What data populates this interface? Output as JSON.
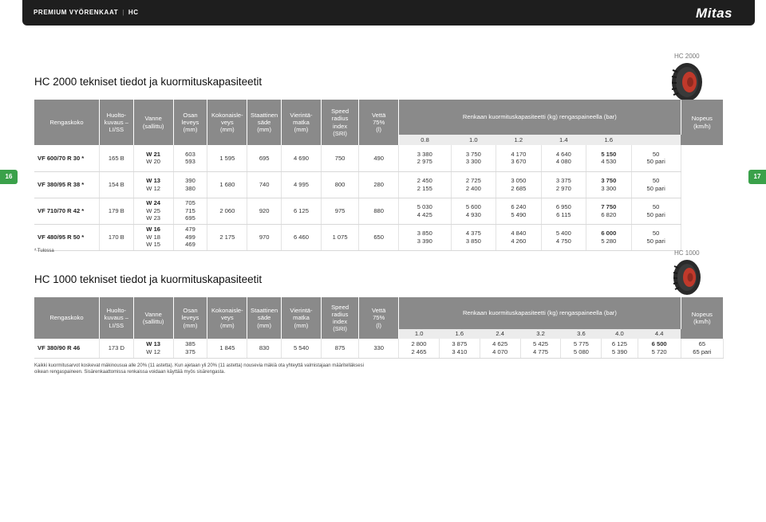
{
  "header": {
    "brand_section": "PREMIUM VYÖRENKAAT",
    "product": "HC",
    "logo": "Mitas"
  },
  "page_numbers": {
    "left": "16",
    "right": "17"
  },
  "hc2000": {
    "label": "HC 2000",
    "title": "HC 2000 tekniset tiedot ja kuormituskapasiteetit",
    "headers": {
      "size": "Rengaskoko",
      "service": "Huolto-\nkuvaus –\nLI/SS",
      "rim": "Vanne\n(sallittu)",
      "width": "Osan\nleveys\n(mm)",
      "height": "Kokonaisle-\nveys\n(mm)",
      "static_radius": "Staattinen\nsäde\n(mm)",
      "rolling": "Vierintä-\nmatka\n(mm)",
      "sri": "Speed\nradius\nindex\n(SRI)",
      "water": "Vettä\n75%\n(l)",
      "capacity": "Renkaan kuormituskapasiteetti (kg) rengaspaineella (bar)",
      "speed": "Nopeus\n(km/h)"
    },
    "pressures": [
      "0.8",
      "1.0",
      "1.2",
      "1.4",
      "1.6"
    ],
    "rows": [
      {
        "size": "VF 600/70 R 30 *",
        "service": "165 B",
        "rim_bold": "W 21",
        "rim_rest": "W 20",
        "width": "603\n593",
        "height": "1 595",
        "static": "695",
        "rolling": "4 690",
        "sri": "750",
        "water": "490",
        "caps": [
          "3 380\n2 975",
          "3 750\n3 300",
          "4 170\n3 670",
          "4 640\n4 080"
        ],
        "cap_last_top": "5 150",
        "cap_last_bot": "4 530",
        "speed": "50\n50 pari"
      },
      {
        "size": "VF 380/95 R 38 *",
        "service": "154 B",
        "rim_bold": "W 13",
        "rim_rest": "W 12",
        "width": "390\n380",
        "height": "1 680",
        "static": "740",
        "rolling": "4 995",
        "sri": "800",
        "water": "280",
        "caps": [
          "2 450\n2 155",
          "2 725\n2 400",
          "3 050\n2 685",
          "3 375\n2 970"
        ],
        "cap_last_top": "3 750",
        "cap_last_bot": "3 300",
        "speed": "50\n50 pari"
      },
      {
        "size": "VF 710/70 R 42 *",
        "service": "179 B",
        "rim_bold": "W 24",
        "rim_rest": "W 25\nW 23",
        "width": "705\n715\n695",
        "height": "2 060",
        "static": "920",
        "rolling": "6 125",
        "sri": "975",
        "water": "880",
        "caps": [
          "5 030\n4 425",
          "5 600\n4 930",
          "6 240\n5 490",
          "6 950\n6 115"
        ],
        "cap_last_top": "7 750",
        "cap_last_bot": "6 820",
        "speed": "50\n50 pari"
      },
      {
        "size": "VF 480/95 R 50 *",
        "service": "170 B",
        "rim_bold": "W 16",
        "rim_rest": "W 18\nW 15",
        "width": "479\n499\n469",
        "height": "2 175",
        "static": "970",
        "rolling": "6 460",
        "sri": "1 075",
        "water": "650",
        "caps": [
          "3 850\n3 390",
          "4 375\n3 850",
          "4 840\n4 260",
          "5 400\n4 750"
        ],
        "cap_last_top": "6 000",
        "cap_last_bot": "5 280",
        "speed": "50\n50 pari"
      }
    ],
    "footnote": "* Tulossa"
  },
  "hc1000": {
    "label": "HC 1000",
    "title": "HC 1000 tekniset tiedot ja kuormituskapasiteetit",
    "headers": {
      "size": "Rengaskoko",
      "service": "Huolto-\nkuvaus –\nLI/SS",
      "rim": "Vanne\n(sallittu)",
      "width": "Osan\nleveys\n(mm)",
      "height": "Kokonaisle-\nveys\n(mm)",
      "static_radius": "Staattinen\nsäde\n(mm)",
      "rolling": "Vierintä-\nmatka\n(mm)",
      "sri": "Speed\nradius\nindex\n(SRI)",
      "water": "Vettä\n75%\n(l)",
      "capacity": "Renkaan kuormituskapasiteetti (kg) rengaspaineella (bar)",
      "speed": "Nopeus\n(km/h)"
    },
    "pressures": [
      "1.0",
      "1.6",
      "2.4",
      "3.2",
      "3.6",
      "4.0",
      "4.4"
    ],
    "rows": [
      {
        "size": "VF 380/90 R 46",
        "service": "173 D",
        "rim_bold": "W 13",
        "rim_rest": "W 12",
        "width": "385\n375",
        "height": "1 845",
        "static": "830",
        "rolling": "5 540",
        "sri": "875",
        "water": "330",
        "caps": [
          "2 800\n2 465",
          "3 875\n3 410",
          "4 625\n4 070",
          "5 425\n4 775",
          "5 775\n5 080",
          "6 125\n5 390"
        ],
        "cap_last_top": "6 500",
        "cap_last_bot": "5 720",
        "speed": "65\n65 pari"
      }
    ],
    "footnote": "Kaikki kuormitusarvot koskevat mäkinousua alle 20% (11 astetta). Kun ajetaan yli 20% (11 astetta) nousevia mäkiä ota yhteyttä valmistajaan määritelläksesi oikean rengaspaineen. Sisärenkaattomissa renkaissa voidaan käyttää myös sisärengasta."
  }
}
